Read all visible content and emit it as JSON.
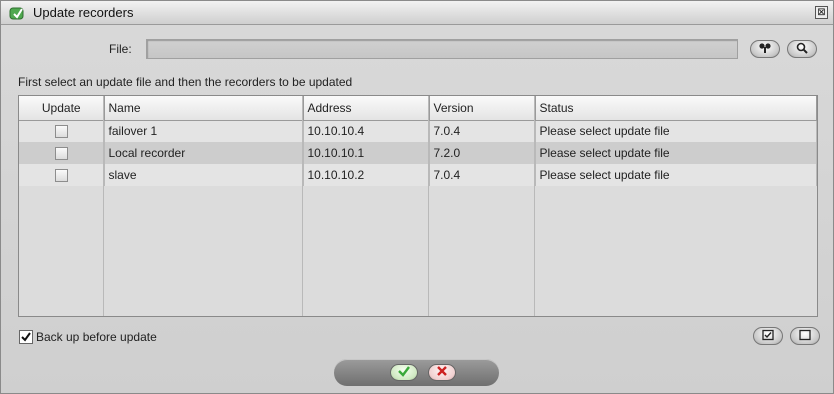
{
  "window": {
    "title": "Update recorders",
    "close_symbol": "⊠"
  },
  "file": {
    "label": "File:",
    "value": "",
    "placeholder": ""
  },
  "instruction": "First select an update file and then the recorders to be updated",
  "table": {
    "columns": [
      "Update",
      "Name",
      "Address",
      "Version",
      "Status"
    ],
    "rows": [
      {
        "checked": false,
        "name": "failover 1",
        "address": "10.10.10.4",
        "version": "7.0.4",
        "status": "Please select update file"
      },
      {
        "checked": false,
        "name": "Local recorder",
        "address": "10.10.10.1",
        "version": "7.2.0",
        "status": "Please select update file"
      },
      {
        "checked": false,
        "name": "slave",
        "address": "10.10.10.2",
        "version": "7.0.4",
        "status": "Please select update file"
      }
    ]
  },
  "backup": {
    "label": "Back up before update",
    "checked": true
  },
  "icons": {
    "app": "recorder-update-icon",
    "browse": "browse-file-icon",
    "search": "magnifier-icon",
    "select_all": "check-all-icon",
    "deselect_all": "uncheck-all-icon",
    "ok": "green-checkmark-icon",
    "cancel": "red-x-icon"
  },
  "colors": {
    "ok": "#3aa93a",
    "cancel": "#cc2222",
    "app_icon": "#4fa84f"
  }
}
